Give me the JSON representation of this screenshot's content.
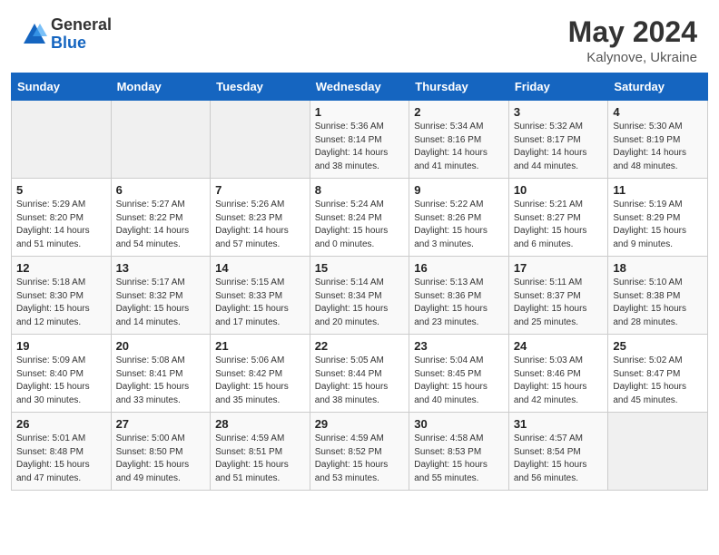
{
  "header": {
    "logo_general": "General",
    "logo_blue": "Blue",
    "title": "May 2024",
    "subtitle": "Kalynove, Ukraine"
  },
  "calendar": {
    "columns": [
      "Sunday",
      "Monday",
      "Tuesday",
      "Wednesday",
      "Thursday",
      "Friday",
      "Saturday"
    ],
    "rows": [
      [
        {
          "day": "",
          "info": ""
        },
        {
          "day": "",
          "info": ""
        },
        {
          "day": "",
          "info": ""
        },
        {
          "day": "1",
          "info": "Sunrise: 5:36 AM\nSunset: 8:14 PM\nDaylight: 14 hours\nand 38 minutes."
        },
        {
          "day": "2",
          "info": "Sunrise: 5:34 AM\nSunset: 8:16 PM\nDaylight: 14 hours\nand 41 minutes."
        },
        {
          "day": "3",
          "info": "Sunrise: 5:32 AM\nSunset: 8:17 PM\nDaylight: 14 hours\nand 44 minutes."
        },
        {
          "day": "4",
          "info": "Sunrise: 5:30 AM\nSunset: 8:19 PM\nDaylight: 14 hours\nand 48 minutes."
        }
      ],
      [
        {
          "day": "5",
          "info": "Sunrise: 5:29 AM\nSunset: 8:20 PM\nDaylight: 14 hours\nand 51 minutes."
        },
        {
          "day": "6",
          "info": "Sunrise: 5:27 AM\nSunset: 8:22 PM\nDaylight: 14 hours\nand 54 minutes."
        },
        {
          "day": "7",
          "info": "Sunrise: 5:26 AM\nSunset: 8:23 PM\nDaylight: 14 hours\nand 57 minutes."
        },
        {
          "day": "8",
          "info": "Sunrise: 5:24 AM\nSunset: 8:24 PM\nDaylight: 15 hours\nand 0 minutes."
        },
        {
          "day": "9",
          "info": "Sunrise: 5:22 AM\nSunset: 8:26 PM\nDaylight: 15 hours\nand 3 minutes."
        },
        {
          "day": "10",
          "info": "Sunrise: 5:21 AM\nSunset: 8:27 PM\nDaylight: 15 hours\nand 6 minutes."
        },
        {
          "day": "11",
          "info": "Sunrise: 5:19 AM\nSunset: 8:29 PM\nDaylight: 15 hours\nand 9 minutes."
        }
      ],
      [
        {
          "day": "12",
          "info": "Sunrise: 5:18 AM\nSunset: 8:30 PM\nDaylight: 15 hours\nand 12 minutes."
        },
        {
          "day": "13",
          "info": "Sunrise: 5:17 AM\nSunset: 8:32 PM\nDaylight: 15 hours\nand 14 minutes."
        },
        {
          "day": "14",
          "info": "Sunrise: 5:15 AM\nSunset: 8:33 PM\nDaylight: 15 hours\nand 17 minutes."
        },
        {
          "day": "15",
          "info": "Sunrise: 5:14 AM\nSunset: 8:34 PM\nDaylight: 15 hours\nand 20 minutes."
        },
        {
          "day": "16",
          "info": "Sunrise: 5:13 AM\nSunset: 8:36 PM\nDaylight: 15 hours\nand 23 minutes."
        },
        {
          "day": "17",
          "info": "Sunrise: 5:11 AM\nSunset: 8:37 PM\nDaylight: 15 hours\nand 25 minutes."
        },
        {
          "day": "18",
          "info": "Sunrise: 5:10 AM\nSunset: 8:38 PM\nDaylight: 15 hours\nand 28 minutes."
        }
      ],
      [
        {
          "day": "19",
          "info": "Sunrise: 5:09 AM\nSunset: 8:40 PM\nDaylight: 15 hours\nand 30 minutes."
        },
        {
          "day": "20",
          "info": "Sunrise: 5:08 AM\nSunset: 8:41 PM\nDaylight: 15 hours\nand 33 minutes."
        },
        {
          "day": "21",
          "info": "Sunrise: 5:06 AM\nSunset: 8:42 PM\nDaylight: 15 hours\nand 35 minutes."
        },
        {
          "day": "22",
          "info": "Sunrise: 5:05 AM\nSunset: 8:44 PM\nDaylight: 15 hours\nand 38 minutes."
        },
        {
          "day": "23",
          "info": "Sunrise: 5:04 AM\nSunset: 8:45 PM\nDaylight: 15 hours\nand 40 minutes."
        },
        {
          "day": "24",
          "info": "Sunrise: 5:03 AM\nSunset: 8:46 PM\nDaylight: 15 hours\nand 42 minutes."
        },
        {
          "day": "25",
          "info": "Sunrise: 5:02 AM\nSunset: 8:47 PM\nDaylight: 15 hours\nand 45 minutes."
        }
      ],
      [
        {
          "day": "26",
          "info": "Sunrise: 5:01 AM\nSunset: 8:48 PM\nDaylight: 15 hours\nand 47 minutes."
        },
        {
          "day": "27",
          "info": "Sunrise: 5:00 AM\nSunset: 8:50 PM\nDaylight: 15 hours\nand 49 minutes."
        },
        {
          "day": "28",
          "info": "Sunrise: 4:59 AM\nSunset: 8:51 PM\nDaylight: 15 hours\nand 51 minutes."
        },
        {
          "day": "29",
          "info": "Sunrise: 4:59 AM\nSunset: 8:52 PM\nDaylight: 15 hours\nand 53 minutes."
        },
        {
          "day": "30",
          "info": "Sunrise: 4:58 AM\nSunset: 8:53 PM\nDaylight: 15 hours\nand 55 minutes."
        },
        {
          "day": "31",
          "info": "Sunrise: 4:57 AM\nSunset: 8:54 PM\nDaylight: 15 hours\nand 56 minutes."
        },
        {
          "day": "",
          "info": ""
        }
      ]
    ]
  }
}
